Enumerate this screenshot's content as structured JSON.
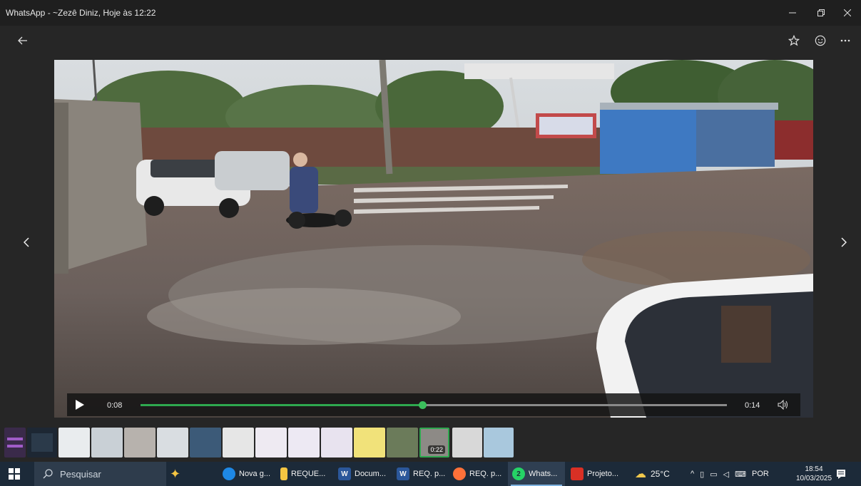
{
  "window": {
    "title": "WhatsApp - ~Zezê Diniz, Hoje às 12:22",
    "minimize_icon": "minimize-icon",
    "restore_icon": "restore-icon",
    "close_icon": "close-icon"
  },
  "toolbar": {
    "back_icon": "back-arrow-icon",
    "star_icon": "star-icon",
    "emoji_icon": "emoji-icon",
    "more_icon": "more-icon"
  },
  "player": {
    "current_time": "0:08",
    "total_time": "0:14",
    "progress": 0.48,
    "play_icon": "play-icon",
    "volume_icon": "volume-icon"
  },
  "filmstrip": {
    "selected_badge": "0:22"
  },
  "taskbar": {
    "search_placeholder": "Pesquisar",
    "apps": [
      {
        "label": "Nova g...",
        "icon": "edge-icon",
        "color": "#1e88e5"
      },
      {
        "label": "REQUE...",
        "icon": "folder-icon",
        "color": "#f4c542"
      },
      {
        "label": "Docum...",
        "icon": "word-icon",
        "color": "#2b579a"
      },
      {
        "label": "REQ. p...",
        "icon": "word-icon",
        "color": "#2b579a"
      },
      {
        "label": "REQ. p...",
        "icon": "firefox-icon",
        "color": "#ff7139"
      },
      {
        "label": "Whats...",
        "icon": "whatsapp-icon",
        "color": "#25d366",
        "badge": "2"
      },
      {
        "label": "Projeto...",
        "icon": "pdf-icon",
        "color": "#d93025"
      }
    ],
    "weather": "25°C",
    "language": "POR",
    "time": "18:54",
    "date": "10/03/2025"
  }
}
